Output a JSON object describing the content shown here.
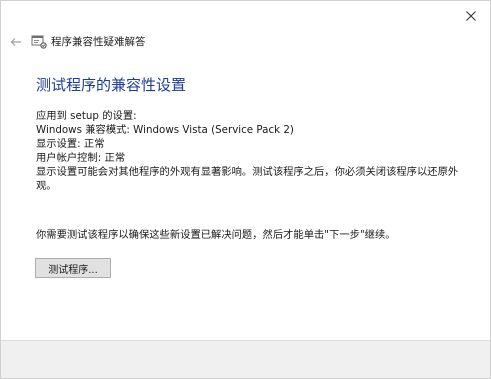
{
  "window": {
    "header_title": "程序兼容性疑难解答"
  },
  "main": {
    "heading": "测试程序的兼容性设置",
    "applied_to": "应用到  setup 的设置:",
    "compat_mode": "Windows 兼容模式: Windows Vista (Service Pack 2)",
    "display_settings": "显示设置:  正常",
    "uac": "用户帐户控制:  正常",
    "note": "显示设置可能会对其他程序的外观有显著影响。测试该程序之后，你必须关闭该程序以还原外观。",
    "prompt": "你需要测试该程序以确保这些新设置已解决问题，然后才能单击\"下一步\"继续。",
    "test_button_label": "测试程序..."
  },
  "icons": {
    "close": "close-icon",
    "back": "back-arrow-icon",
    "app": "troubleshooter-icon"
  }
}
